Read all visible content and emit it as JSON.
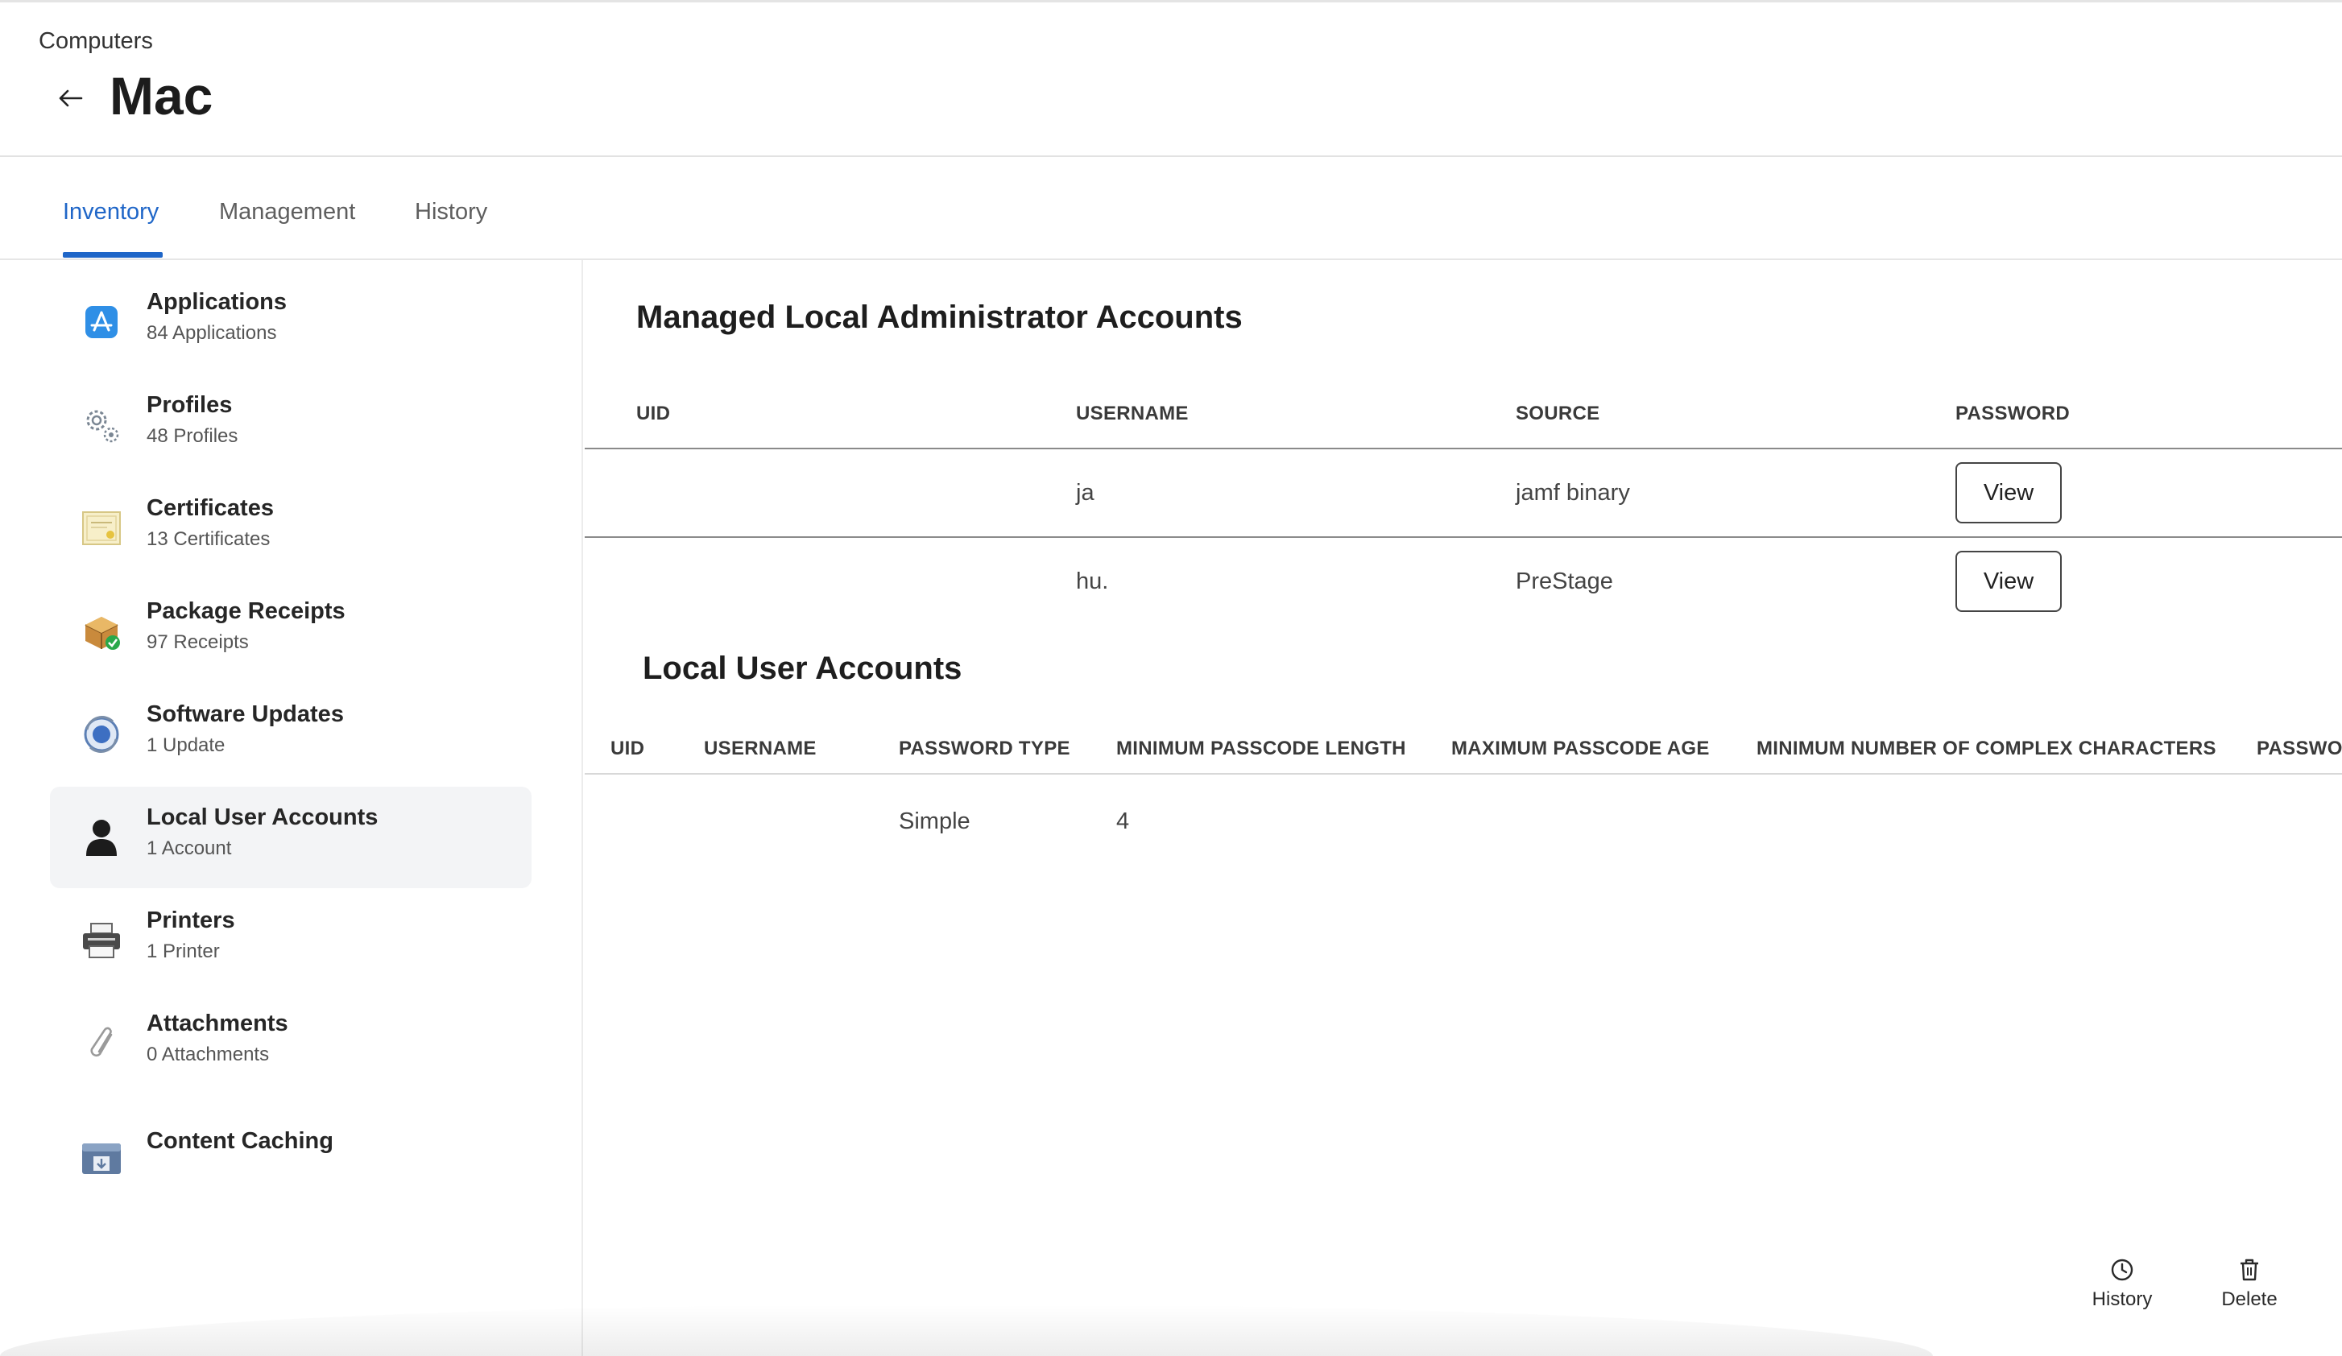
{
  "header": {
    "breadcrumb": "Computers",
    "title": "Mac"
  },
  "tabs": [
    {
      "label": "Inventory",
      "active": true
    },
    {
      "label": "Management",
      "active": false
    },
    {
      "label": "History",
      "active": false
    }
  ],
  "sidebar": {
    "items": [
      {
        "label": "Applications",
        "sub": "84 Applications",
        "icon": "app-store-icon"
      },
      {
        "label": "Profiles",
        "sub": "48 Profiles",
        "icon": "gears-icon"
      },
      {
        "label": "Certificates",
        "sub": "13 Certificates",
        "icon": "certificate-icon"
      },
      {
        "label": "Package Receipts",
        "sub": "97 Receipts",
        "icon": "package-icon"
      },
      {
        "label": "Software Updates",
        "sub": "1 Update",
        "icon": "software-update-icon"
      },
      {
        "label": "Local User Accounts",
        "sub": "1 Account",
        "icon": "user-silhouette-icon",
        "selected": true
      },
      {
        "label": "Printers",
        "sub": "1 Printer",
        "icon": "printer-icon"
      },
      {
        "label": "Attachments",
        "sub": "0 Attachments",
        "icon": "paperclip-icon"
      },
      {
        "label": "Content Caching",
        "sub": "",
        "icon": "content-caching-icon"
      }
    ]
  },
  "admin_accounts": {
    "title": "Managed Local Administrator Accounts",
    "columns": [
      "UID",
      "USERNAME",
      "SOURCE",
      "PASSWORD"
    ],
    "rows": [
      {
        "uid": "",
        "username": "ja",
        "source": "jamf binary",
        "password_button": "View"
      },
      {
        "uid": "",
        "username": "hu.",
        "source": "PreStage",
        "password_button": "View"
      }
    ]
  },
  "local_accounts": {
    "title": "Local User Accounts",
    "columns": [
      "UID",
      "USERNAME",
      "PASSWORD TYPE",
      "MINIMUM PASSCODE LENGTH",
      "MAXIMUM PASSCODE AGE",
      "MINIMUM NUMBER OF COMPLEX CHARACTERS",
      "PASSWO"
    ],
    "rows": [
      {
        "uid": "",
        "username": "",
        "password_type": "Simple",
        "min_length": "4",
        "max_age": "",
        "min_complex": ""
      }
    ]
  },
  "actions": {
    "history_label": "History",
    "delete_label": "Delete"
  },
  "colors": {
    "accent": "#1f66c8",
    "selected_bg": "#f3f4f6"
  }
}
